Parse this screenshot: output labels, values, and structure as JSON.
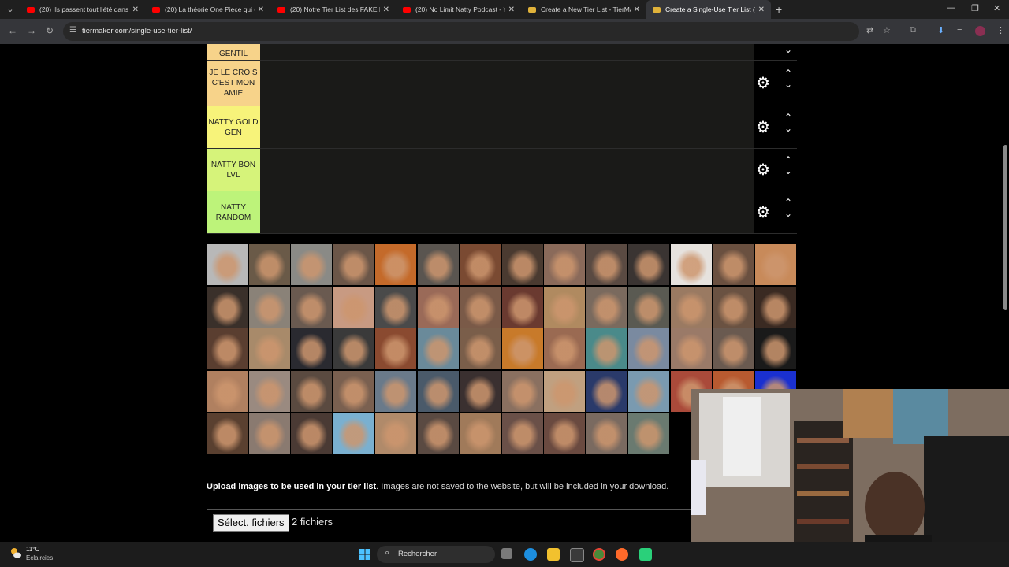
{
  "browser": {
    "tabs": [
      {
        "title": "(20) Ils passent tout l'été dans l",
        "favicon": "youtube-icon",
        "active": false
      },
      {
        "title": "(20) La théorie One Piece qui est",
        "favicon": "youtube-icon",
        "active": false
      },
      {
        "title": "(20) Notre Tier List des FAKE Na",
        "favicon": "youtube-icon",
        "active": false
      },
      {
        "title": "(20) No Limit Natty Podcast - Y",
        "favicon": "youtube-icon",
        "active": false
      },
      {
        "title": "Create a New Tier List - TierMak",
        "favicon": "tiermaker-icon",
        "active": false
      },
      {
        "title": "Create a Single-Use Tier List (F",
        "favicon": "tiermaker-icon",
        "active": true
      }
    ],
    "url": "tiermaker.com/single-use-tier-list/"
  },
  "tiers": [
    {
      "label": "GENTIL",
      "color": "#f7d38a"
    },
    {
      "label": "JE LE CROIS C'EST MON AMIE",
      "color": "#f7d38a"
    },
    {
      "label": "NATTY GOLD GEN",
      "color": "#f7f37a"
    },
    {
      "label": "NATTY BON LVL",
      "color": "#d6f37a"
    },
    {
      "label": "NATTY RANDOM",
      "color": "#bdf37a"
    }
  ],
  "image_pool": {
    "rows": 5,
    "columns": 14,
    "tile_colors": [
      "#b8b8b8",
      "#6a5a48",
      "#8a8a86",
      "#6b5648",
      "#c46a2a",
      "#5a5550",
      "#7a4a32",
      "#4a3a30",
      "#8a6a5a",
      "#5a4a42",
      "#3a3432",
      "#e6e2de",
      "#6a5040",
      "#c88a5a",
      "#3a302a",
      "#8a8278",
      "#6a5a50",
      "#c89a82",
      "#4a4a4a",
      "#9a6a58",
      "#7a5a48",
      "#6a3a30",
      "#b08a60",
      "#7a6a5e",
      "#5a5a52",
      "#9a7a62",
      "#6a5242",
      "#3a2a22",
      "#5a3e30",
      "#a88a6a",
      "#2a2a30",
      "#3a3a3a",
      "#8a4a30",
      "#6a8a9a",
      "#7a5e4a",
      "#c87a2a",
      "#9a6a52",
      "#4a8a8a",
      "#7a8aa0",
      "#9a7a68",
      "#6a5a50",
      "#1a1a1a",
      "#b08060",
      "#9a8a80",
      "#5a4a40",
      "#7a6050",
      "#6a7a8a",
      "#4a5a6a",
      "#3a3030",
      "#8a7060",
      "#c0a080",
      "#2a3a6a",
      "#7a9ab0",
      "#aa4a3a",
      "#b85a30",
      "#1a30d0",
      "#5a4030",
      "#8a7a70",
      "#4a3a34",
      "#7ab0d0",
      "#b08a6a",
      "#5a4a42",
      "#a07a5a",
      "#6a5048",
      "#6a4a40",
      "#7a6a60",
      "#6a7a70",
      "#000000",
      "#000000",
      "#000000"
    ]
  },
  "upload": {
    "bold": "Upload images to be used in your tier list",
    "rest": ". Images are not saved to the website, but will be included in your download.",
    "button": "Sélect. fichiers",
    "count": "2 fichiers"
  },
  "taskbar": {
    "temperature": "11°C",
    "weather": "Eclaircies",
    "search_placeholder": "Rechercher"
  }
}
